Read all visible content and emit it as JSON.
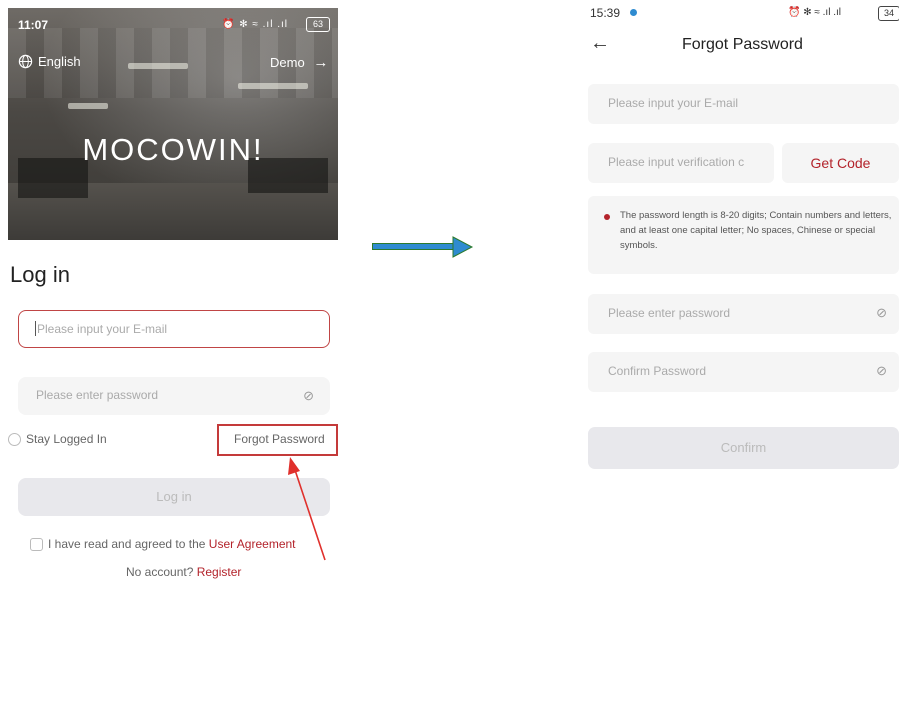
{
  "left_screen": {
    "status_time": "11:07",
    "status_icons": "⏰ ✻ ≈ .ıl .ıl",
    "battery": "63",
    "language": "English",
    "demo": "Demo",
    "brand": "MOCOWIN!",
    "title": "Log in",
    "email_placeholder": "Please input your E-mail",
    "password_placeholder": "Please enter password",
    "stay_logged_in": "Stay Logged In",
    "forgot_password": "Forgot Password",
    "login_button": "Log in",
    "agreement_text": "I have read and agreed to the ",
    "agreement_link": "User Agreement",
    "no_account_text": "No account? ",
    "register_link": "Register"
  },
  "right_screen": {
    "status_time": "15:39",
    "status_icons": "⏰ ✻ ≈ .ıl .ıl",
    "battery": "34",
    "title": "Forgot Password",
    "email_placeholder": "Please input your E-mail",
    "code_placeholder": "Please input verification c",
    "get_code": "Get Code",
    "hint": "The password length is 8-20 digits; Contain numbers and letters, and at least one capital letter; No spaces, Chinese or special symbols.",
    "password_placeholder": "Please enter password",
    "confirm_placeholder": "Confirm Password",
    "confirm_button": "Confirm"
  },
  "colors": {
    "accent_red": "#b3232b",
    "arrow_fill": "#2e8bd0",
    "arrow_border": "#2c7a2c",
    "annotation_red": "#e0302c"
  }
}
